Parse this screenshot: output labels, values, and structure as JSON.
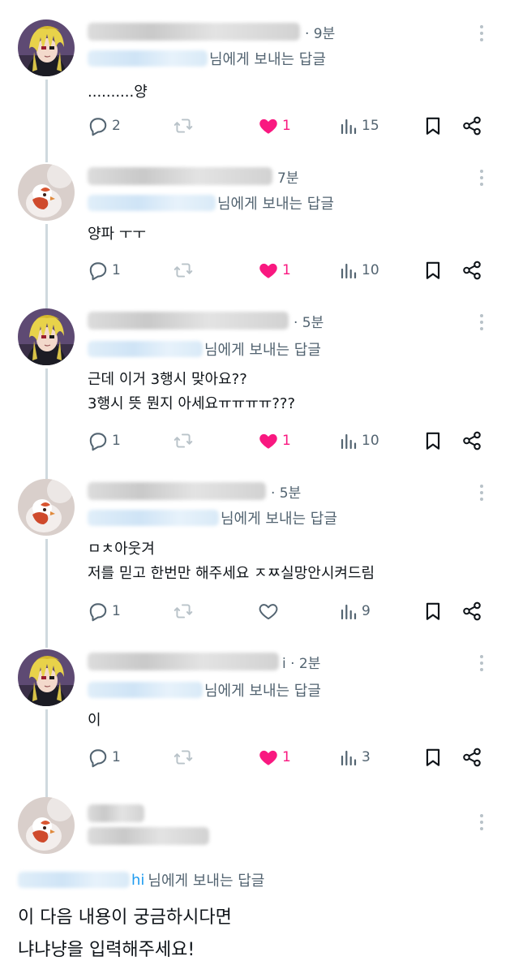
{
  "tweets": [
    {
      "id": 1,
      "time": "· 9분",
      "reply_suffix": "님에게 보내는 답글",
      "lines": [
        "..........양"
      ],
      "replies": "2",
      "retweets": "",
      "likes": "1",
      "liked": true,
      "views": "15",
      "avatar": "blonde"
    },
    {
      "id": 2,
      "time": "7분",
      "reply_suffix": "님에게 보내는 답글",
      "lines": [
        "양파 ㅜㅜ"
      ],
      "replies": "1",
      "retweets": "",
      "likes": "1",
      "liked": true,
      "views": "10",
      "avatar": "bird"
    },
    {
      "id": 3,
      "time": "· 5분",
      "reply_suffix": "님에게 보내는 답글",
      "lines": [
        "근데 이거 3행시 맞아요??",
        "3행시 뜻 뭔지 아세요ㅠㅠㅠㅠ???"
      ],
      "replies": "1",
      "retweets": "",
      "likes": "1",
      "liked": true,
      "views": "10",
      "avatar": "blonde"
    },
    {
      "id": 4,
      "time": "· 5분",
      "reply_suffix": "님에게 보내는 답글",
      "lines": [
        "ㅁㅊ아웃겨",
        "저를 믿고 한번만 해주세요 ㅈㅉ실망안시켜드림"
      ],
      "replies": "1",
      "retweets": "",
      "likes": "",
      "liked": false,
      "views": "9",
      "avatar": "bird"
    },
    {
      "id": 5,
      "time": "i · 2분",
      "reply_suffix": "님에게 보내는 답글",
      "lines": [
        "이"
      ],
      "replies": "1",
      "retweets": "",
      "likes": "1",
      "liked": true,
      "views": "3",
      "avatar": "blonde"
    }
  ],
  "final_tweet": {
    "reply_prefix": "hi",
    "reply_suffix": "님에게 보내는 답글",
    "lines": [
      "이 다음 내용이 궁금하시다면",
      "냐냐냥을 입력해주세요!"
    ]
  },
  "colors": {
    "like": "#f91880",
    "secondary_text": "#536471",
    "thread_line": "#cfd9de",
    "text": "#0f1419"
  },
  "icons": [
    "reply-icon",
    "retweet-icon",
    "heart-icon",
    "views-icon",
    "bookmark-icon",
    "share-icon",
    "more-icon"
  ]
}
